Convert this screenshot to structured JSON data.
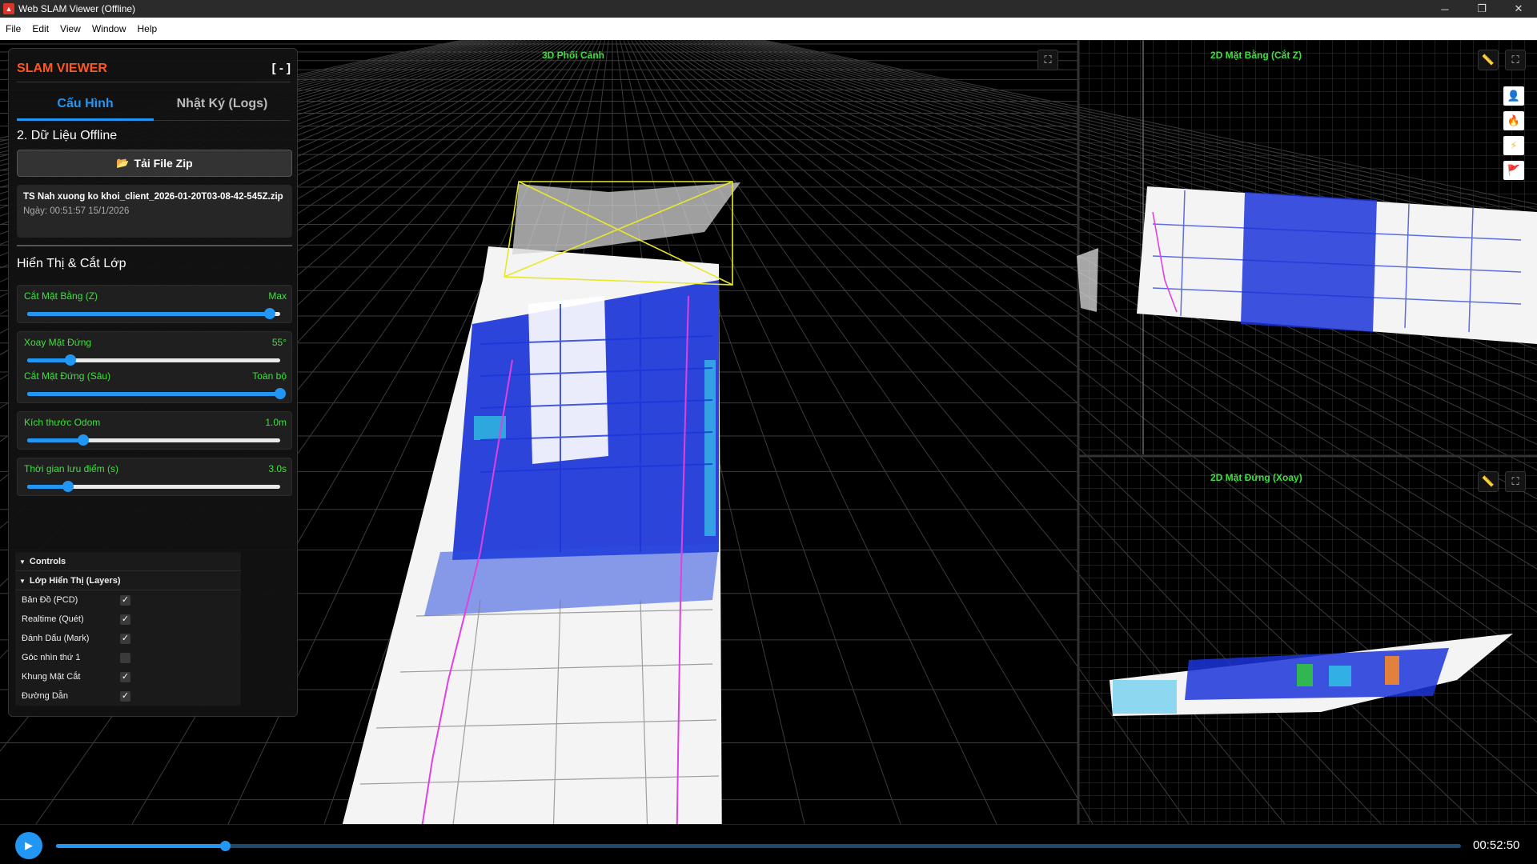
{
  "window": {
    "title": "Web SLAM Viewer (Offline)",
    "minimize": "─",
    "maximize": "❐",
    "close": "✕"
  },
  "menu": [
    "File",
    "Edit",
    "View",
    "Window",
    "Help"
  ],
  "views": {
    "perspective_title": "3D Phối Cảnh",
    "plan_title": "2D Mặt Bằng (Cắt Z)",
    "elevation_title": "2D Mặt Đứng (Xoay)"
  },
  "panel": {
    "title": "SLAM VIEWER",
    "collapse_label": "[ - ]",
    "tabs": [
      {
        "label": "Cấu Hình",
        "active": true
      },
      {
        "label": "Nhật Ký (Logs)",
        "active": false
      }
    ],
    "offline_section": "2. Dữ Liệu Offline",
    "load_button": "Tải File Zip",
    "file": {
      "name": "TS Nah xuong ko khoi_client_2026-01-20T03-08-42-545Z.zip",
      "date": "Ngày: 00:51:57 15/1/2026"
    },
    "display_section": "Hiển Thị & Cắt Lớp",
    "sliders": [
      {
        "label": "Cắt Mặt Bằng (Z)",
        "value": "Max",
        "fraction": 0.96
      },
      {
        "label": "Xoay Mặt Đứng",
        "value": "55°",
        "fraction": 0.17
      },
      {
        "label": "Cắt Mặt Đứng (Sâu)",
        "value": "Toàn bộ",
        "fraction": 1.0
      },
      {
        "label": "Kích thước Odom",
        "value": "1.0m",
        "fraction": 0.22
      },
      {
        "label": "Thời gian lưu điểm (s)",
        "value": "3.0s",
        "fraction": 0.16
      }
    ]
  },
  "gui": {
    "controls_label": "Controls",
    "layers_label": "Lớp Hiển Thị (Layers)",
    "layers": [
      {
        "label": "Bản Đồ (PCD)",
        "checked": true
      },
      {
        "label": "Realtime (Quét)",
        "checked": true
      },
      {
        "label": "Đánh Dấu (Mark)",
        "checked": true
      },
      {
        "label": "Góc nhìn thứ 1",
        "checked": false
      },
      {
        "label": "Khung Mặt Cắt",
        "checked": true
      },
      {
        "label": "Đường Dẫn",
        "checked": true
      }
    ]
  },
  "playback": {
    "time": "00:52:50",
    "progress": 0.12
  },
  "colors": {
    "accent": "#2196f3",
    "title_orange": "#ff5722",
    "label_green": "#3ee03e",
    "frustum_yellow": "#e8e82a",
    "path_magenta": "#e040e0"
  }
}
